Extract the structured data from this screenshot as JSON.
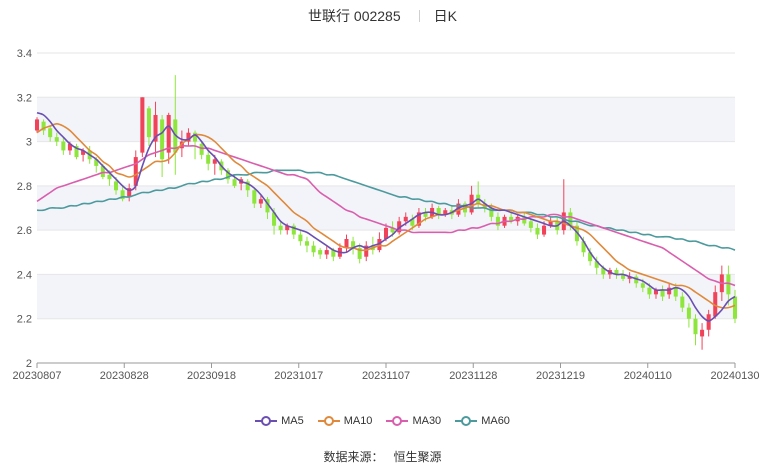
{
  "header": {
    "title": "世联行 002285",
    "period": "日K"
  },
  "source": {
    "label": "数据来源：",
    "value": "恒生聚源"
  },
  "colors": {
    "up": "#f0435a",
    "down": "#8ee63c",
    "grid": "#e6e6e6",
    "band": "#f3f4f9",
    "ma5": "#6a4fb3",
    "ma10": "#e0893a",
    "ma30": "#d95fae",
    "ma60": "#4c9a9d"
  },
  "chart_data": {
    "type": "candlestick",
    "title": "世联行 002285",
    "ylim": [
      2,
      3.4
    ],
    "yticks": [
      "2",
      "2.2",
      "2.4",
      "2.6",
      "2.8",
      "3",
      "3.2",
      "3.4"
    ],
    "xticks": [
      "20230807",
      "20230828",
      "20230918",
      "20231017",
      "20231107",
      "20231128",
      "20231219",
      "20240110",
      "20240130"
    ],
    "legend_position": "bottom-center",
    "series": [
      {
        "name": "MA5",
        "color": "#6a4fb3",
        "values": [
          3.13,
          3.12,
          3.09,
          3.05,
          3.02,
          2.99,
          2.97,
          2.96,
          2.94,
          2.92,
          2.89,
          2.86,
          2.83,
          2.8,
          2.78,
          2.8,
          2.89,
          2.97,
          3.02,
          3.04,
          3.07,
          3.03,
          3.01,
          3.01,
          3.03,
          3.0,
          2.96,
          2.93,
          2.89,
          2.86,
          2.84,
          2.82,
          2.81,
          2.79,
          2.76,
          2.72,
          2.68,
          2.64,
          2.62,
          2.61,
          2.6,
          2.59,
          2.57,
          2.55,
          2.53,
          2.51,
          2.5,
          2.5,
          2.52,
          2.53,
          2.52,
          2.53,
          2.54,
          2.56,
          2.58,
          2.61,
          2.63,
          2.65,
          2.67,
          2.68,
          2.68,
          2.67,
          2.67,
          2.68,
          2.7,
          2.71,
          2.72,
          2.74,
          2.72,
          2.7,
          2.69,
          2.69,
          2.68,
          2.67,
          2.66,
          2.65,
          2.64,
          2.63,
          2.62,
          2.62,
          2.64,
          2.62,
          2.59,
          2.55,
          2.5,
          2.46,
          2.43,
          2.41,
          2.4,
          2.4,
          2.39,
          2.38,
          2.37,
          2.35,
          2.33,
          2.33,
          2.33,
          2.34,
          2.33,
          2.3,
          2.25,
          2.21,
          2.19,
          2.21,
          2.24,
          2.28,
          2.3
        ]
      },
      {
        "name": "MA10",
        "color": "#e0893a",
        "values": [
          3.04,
          3.06,
          3.07,
          3.08,
          3.07,
          3.05,
          3.02,
          2.99,
          2.96,
          2.94,
          2.91,
          2.89,
          2.86,
          2.85,
          2.84,
          2.85,
          2.87,
          2.89,
          2.91,
          2.91,
          2.92,
          2.95,
          2.99,
          3.01,
          3.03,
          3.03,
          3.02,
          3.0,
          2.97,
          2.94,
          2.91,
          2.89,
          2.86,
          2.84,
          2.82,
          2.8,
          2.77,
          2.74,
          2.71,
          2.68,
          2.66,
          2.64,
          2.61,
          2.59,
          2.57,
          2.55,
          2.53,
          2.52,
          2.52,
          2.51,
          2.51,
          2.52,
          2.53,
          2.53,
          2.55,
          2.57,
          2.59,
          2.61,
          2.63,
          2.65,
          2.66,
          2.67,
          2.67,
          2.68,
          2.69,
          2.7,
          2.71,
          2.72,
          2.71,
          2.71,
          2.7,
          2.69,
          2.69,
          2.68,
          2.68,
          2.67,
          2.66,
          2.65,
          2.64,
          2.64,
          2.63,
          2.62,
          2.61,
          2.6,
          2.58,
          2.55,
          2.52,
          2.49,
          2.46,
          2.44,
          2.42,
          2.41,
          2.4,
          2.39,
          2.38,
          2.37,
          2.36,
          2.35,
          2.35,
          2.34,
          2.32,
          2.3,
          2.28,
          2.26,
          2.25,
          2.25,
          2.26
        ]
      },
      {
        "name": "MA30",
        "color": "#d95fae",
        "values": [
          2.73,
          2.75,
          2.77,
          2.79,
          2.8,
          2.81,
          2.82,
          2.83,
          2.84,
          2.85,
          2.86,
          2.86,
          2.87,
          2.88,
          2.89,
          2.9,
          2.92,
          2.94,
          2.95,
          2.96,
          2.97,
          2.97,
          2.98,
          2.98,
          2.98,
          2.97,
          2.97,
          2.96,
          2.95,
          2.94,
          2.93,
          2.92,
          2.91,
          2.9,
          2.89,
          2.88,
          2.87,
          2.86,
          2.85,
          2.85,
          2.84,
          2.83,
          2.8,
          2.77,
          2.75,
          2.73,
          2.71,
          2.69,
          2.68,
          2.66,
          2.65,
          2.64,
          2.63,
          2.62,
          2.61,
          2.6,
          2.6,
          2.59,
          2.59,
          2.59,
          2.59,
          2.59,
          2.59,
          2.59,
          2.6,
          2.6,
          2.61,
          2.61,
          2.62,
          2.63,
          2.63,
          2.64,
          2.64,
          2.65,
          2.65,
          2.66,
          2.66,
          2.66,
          2.67,
          2.67,
          2.66,
          2.66,
          2.65,
          2.64,
          2.63,
          2.62,
          2.61,
          2.6,
          2.59,
          2.58,
          2.57,
          2.56,
          2.55,
          2.54,
          2.53,
          2.52,
          2.5,
          2.48,
          2.46,
          2.44,
          2.42,
          2.4,
          2.38,
          2.37,
          2.36,
          2.36,
          2.35
        ]
      },
      {
        "name": "MA60",
        "color": "#4c9a9d",
        "values": [
          2.69,
          2.69,
          2.7,
          2.7,
          2.7,
          2.71,
          2.71,
          2.72,
          2.72,
          2.73,
          2.73,
          2.74,
          2.74,
          2.75,
          2.75,
          2.76,
          2.77,
          2.77,
          2.78,
          2.78,
          2.79,
          2.79,
          2.8,
          2.81,
          2.81,
          2.82,
          2.82,
          2.83,
          2.83,
          2.84,
          2.85,
          2.85,
          2.85,
          2.86,
          2.86,
          2.86,
          2.87,
          2.87,
          2.87,
          2.87,
          2.87,
          2.86,
          2.86,
          2.86,
          2.85,
          2.85,
          2.84,
          2.83,
          2.82,
          2.81,
          2.8,
          2.79,
          2.78,
          2.77,
          2.76,
          2.75,
          2.75,
          2.74,
          2.74,
          2.73,
          2.73,
          2.72,
          2.72,
          2.71,
          2.71,
          2.71,
          2.7,
          2.7,
          2.7,
          2.69,
          2.69,
          2.69,
          2.69,
          2.68,
          2.68,
          2.68,
          2.67,
          2.67,
          2.66,
          2.66,
          2.65,
          2.64,
          2.64,
          2.63,
          2.62,
          2.62,
          2.61,
          2.61,
          2.6,
          2.6,
          2.59,
          2.59,
          2.58,
          2.58,
          2.57,
          2.57,
          2.57,
          2.56,
          2.56,
          2.55,
          2.55,
          2.54,
          2.53,
          2.53,
          2.52,
          2.52,
          2.51
        ]
      }
    ],
    "candles_ohlc": [
      [
        3.05,
        3.1,
        3.11,
        3.04
      ],
      [
        3.09,
        3.05,
        3.1,
        3.03
      ],
      [
        3.06,
        3.02,
        3.07,
        3.0
      ],
      [
        3.02,
        3.0,
        3.04,
        2.98
      ],
      [
        3.0,
        2.96,
        3.02,
        2.94
      ],
      [
        2.96,
        2.99,
        3.0,
        2.94
      ],
      [
        2.98,
        2.93,
        2.99,
        2.92
      ],
      [
        2.94,
        2.96,
        2.97,
        2.91
      ],
      [
        2.96,
        2.92,
        2.98,
        2.9
      ],
      [
        2.92,
        2.89,
        2.93,
        2.86
      ],
      [
        2.89,
        2.84,
        2.9,
        2.83
      ],
      [
        2.85,
        2.83,
        2.87,
        2.8
      ],
      [
        2.82,
        2.78,
        2.84,
        2.76
      ],
      [
        2.78,
        2.74,
        2.8,
        2.73
      ],
      [
        2.75,
        2.79,
        2.81,
        2.73
      ],
      [
        2.8,
        2.93,
        2.96,
        2.78
      ],
      [
        2.95,
        3.2,
        3.2,
        2.93
      ],
      [
        3.15,
        3.02,
        3.16,
        2.98
      ],
      [
        3.0,
        3.12,
        3.18,
        2.93
      ],
      [
        3.1,
        2.92,
        3.12,
        2.84
      ],
      [
        2.95,
        3.12,
        3.13,
        2.9
      ],
      [
        3.1,
        2.95,
        3.3,
        2.85
      ],
      [
        2.97,
        3.0,
        3.05,
        2.93
      ],
      [
        3.0,
        3.04,
        3.06,
        2.98
      ],
      [
        3.04,
        3.0,
        3.05,
        2.92
      ],
      [
        2.99,
        2.94,
        3.0,
        2.92
      ],
      [
        2.94,
        2.9,
        2.96,
        2.87
      ],
      [
        2.9,
        2.92,
        2.94,
        2.85
      ],
      [
        2.91,
        2.87,
        2.92,
        2.85
      ],
      [
        2.87,
        2.83,
        2.88,
        2.81
      ],
      [
        2.83,
        2.8,
        2.85,
        2.79
      ],
      [
        2.81,
        2.83,
        2.84,
        2.78
      ],
      [
        2.82,
        2.78,
        2.83,
        2.75
      ],
      [
        2.78,
        2.72,
        2.79,
        2.7
      ],
      [
        2.72,
        2.74,
        2.76,
        2.7
      ],
      [
        2.74,
        2.68,
        2.75,
        2.65
      ],
      [
        2.68,
        2.62,
        2.7,
        2.58
      ],
      [
        2.62,
        2.6,
        2.64,
        2.58
      ],
      [
        2.6,
        2.62,
        2.63,
        2.58
      ],
      [
        2.62,
        2.58,
        2.63,
        2.56
      ],
      [
        2.58,
        2.55,
        2.6,
        2.53
      ],
      [
        2.55,
        2.53,
        2.57,
        2.5
      ],
      [
        2.53,
        2.5,
        2.55,
        2.48
      ],
      [
        2.51,
        2.49,
        2.52,
        2.47
      ],
      [
        2.49,
        2.51,
        2.53,
        2.47
      ],
      [
        2.51,
        2.48,
        2.52,
        2.46
      ],
      [
        2.48,
        2.52,
        2.54,
        2.47
      ],
      [
        2.52,
        2.56,
        2.58,
        2.5
      ],
      [
        2.55,
        2.52,
        2.57,
        2.49
      ],
      [
        2.52,
        2.47,
        2.54,
        2.45
      ],
      [
        2.48,
        2.53,
        2.55,
        2.46
      ],
      [
        2.53,
        2.51,
        2.57,
        2.49
      ],
      [
        2.51,
        2.56,
        2.59,
        2.5
      ],
      [
        2.56,
        2.61,
        2.63,
        2.55
      ],
      [
        2.61,
        2.59,
        2.64,
        2.57
      ],
      [
        2.59,
        2.64,
        2.66,
        2.58
      ],
      [
        2.64,
        2.66,
        2.68,
        2.62
      ],
      [
        2.65,
        2.62,
        2.67,
        2.6
      ],
      [
        2.62,
        2.68,
        2.7,
        2.61
      ],
      [
        2.68,
        2.66,
        2.7,
        2.64
      ],
      [
        2.66,
        2.7,
        2.72,
        2.65
      ],
      [
        2.7,
        2.67,
        2.71,
        2.65
      ],
      [
        2.67,
        2.69,
        2.7,
        2.66
      ],
      [
        2.69,
        2.67,
        2.71,
        2.65
      ],
      [
        2.67,
        2.72,
        2.74,
        2.66
      ],
      [
        2.72,
        2.68,
        2.73,
        2.66
      ],
      [
        2.68,
        2.76,
        2.8,
        2.67
      ],
      [
        2.76,
        2.72,
        2.82,
        2.7
      ],
      [
        2.72,
        2.7,
        2.74,
        2.68
      ],
      [
        2.7,
        2.66,
        2.72,
        2.64
      ],
      [
        2.66,
        2.62,
        2.68,
        2.6
      ],
      [
        2.62,
        2.66,
        2.67,
        2.61
      ],
      [
        2.66,
        2.64,
        2.68,
        2.63
      ],
      [
        2.64,
        2.66,
        2.67,
        2.62
      ],
      [
        2.66,
        2.63,
        2.68,
        2.62
      ],
      [
        2.64,
        2.61,
        2.65,
        2.59
      ],
      [
        2.61,
        2.58,
        2.63,
        2.56
      ],
      [
        2.58,
        2.62,
        2.64,
        2.57
      ],
      [
        2.62,
        2.64,
        2.66,
        2.61
      ],
      [
        2.64,
        2.6,
        2.66,
        2.58
      ],
      [
        2.6,
        2.68,
        2.83,
        2.58
      ],
      [
        2.68,
        2.62,
        2.7,
        2.6
      ],
      [
        2.62,
        2.55,
        2.64,
        2.53
      ],
      [
        2.55,
        2.5,
        2.57,
        2.48
      ],
      [
        2.5,
        2.46,
        2.52,
        2.44
      ],
      [
        2.46,
        2.43,
        2.48,
        2.4
      ],
      [
        2.43,
        2.4,
        2.44,
        2.38
      ],
      [
        2.4,
        2.42,
        2.43,
        2.38
      ],
      [
        2.42,
        2.4,
        2.43,
        2.38
      ],
      [
        2.4,
        2.38,
        2.42,
        2.37
      ],
      [
        2.38,
        2.39,
        2.41,
        2.36
      ],
      [
        2.39,
        2.36,
        2.4,
        2.34
      ],
      [
        2.36,
        2.34,
        2.38,
        2.32
      ],
      [
        2.34,
        2.31,
        2.36,
        2.29
      ],
      [
        2.31,
        2.33,
        2.34,
        2.29
      ],
      [
        2.33,
        2.3,
        2.35,
        2.28
      ],
      [
        2.31,
        2.34,
        2.36,
        2.29
      ],
      [
        2.34,
        2.3,
        2.36,
        2.28
      ],
      [
        2.3,
        2.25,
        2.32,
        2.23
      ],
      [
        2.25,
        2.2,
        2.27,
        2.16
      ],
      [
        2.2,
        2.13,
        2.22,
        2.08
      ],
      [
        2.12,
        2.15,
        2.18,
        2.06
      ],
      [
        2.15,
        2.22,
        2.24,
        2.12
      ],
      [
        2.21,
        2.32,
        2.35,
        2.2
      ],
      [
        2.32,
        2.4,
        2.44,
        2.28
      ],
      [
        2.4,
        2.31,
        2.44,
        2.26
      ],
      [
        2.3,
        2.2,
        2.33,
        2.18
      ]
    ]
  }
}
